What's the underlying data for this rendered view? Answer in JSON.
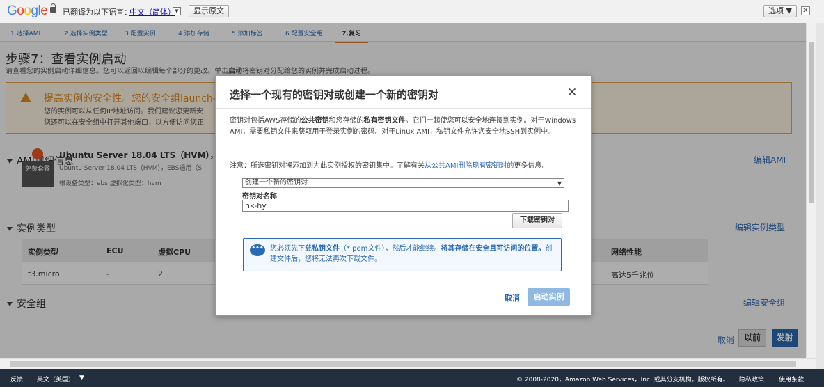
{
  "google_bar": {
    "translated_label": "已翻译为以下语言：",
    "language": "中文（简体）",
    "show_original": "显示原文",
    "options": "选项 ▼",
    "close": "✕"
  },
  "steps": [
    "1.选择AMI",
    "2.选择实例类型",
    "3.配置实例",
    "4.添加存储",
    "5.添加标签",
    "6.配置安全组",
    "7.复习"
  ],
  "page": {
    "title": "步骤7：查看实例启动",
    "subtitle_prefix": "请查看您的实例启动详细信息。您可以返回以编辑每个部分的更改。单击",
    "subtitle_bold": "启动",
    "subtitle_suffix": "将密钥对分配给您的实例并完成启动过程。",
    "warning_title": "提高实例的安全性。您的安全组launch-w",
    "warning_line1": "您的实例可以从任何IP地址访问。我们建议您更新安",
    "warning_line2": "您还可以在安全组中打开其他端口，以方便访问您正"
  },
  "ami": {
    "section": "AMI详细信息",
    "edit": "编辑AMI",
    "free_tag": "免费套餐",
    "name": "Ubuntu Server 18.04 LTS（HVM），SSD卷",
    "desc": "Ubuntu Server 18.04 LTS（HVM），EBS通用（S",
    "meta": "根设备类型：ebs    虚拟化类型：hvm"
  },
  "instance_type": {
    "section": "实例类型",
    "edit": "编辑实例类型",
    "headers": [
      "实例类型",
      "ECU",
      "虚拟CPU",
      "网络性能"
    ],
    "row": [
      "t3.micro",
      "-",
      "2",
      "高达5千兆位"
    ]
  },
  "security_group": {
    "section": "安全组",
    "edit": "编辑安全组"
  },
  "bottom_nav": {
    "cancel": "取消",
    "previous": "以前",
    "launch": "发射"
  },
  "footer": {
    "feedback": "反馈",
    "language": "英文（美国）",
    "copyright": "© 2008-2020，Amazon Web Services，Inc. 或其分支机构。版权所有。",
    "privacy": "隐私政策",
    "terms": "使用条款"
  },
  "modal": {
    "title": "选择一个现有的密钥对或创建一个新的密钥对",
    "close": "✕",
    "p1_a": "密钥对包括AWS存储的",
    "p1_b": "公共密钥",
    "p1_c": "和您存储的",
    "p1_d": "私有密钥文件",
    "p1_e": "。它们一起使您可以安全地连接到实例。对于Windows AMI，需要私钥文件来获取用于登录实例的密码。对于Linux AMI，私钥文件允许您安全地SSH到实例中。",
    "note_a": "注意：所选密钥对将添加到为此实例授权的密钥集中。了解有关",
    "note_link": "从公共AMI删除现有密钥对的",
    "note_b": "更多信息。",
    "select_value": "创建一个新的密钥对",
    "key_name_label": "密钥对名称",
    "key_name_value": "hk-hy",
    "download": "下载密钥对",
    "info_a": "您必须先下载",
    "info_b": "私钥文件",
    "info_c": "（*.pem文件），然后才能继续。",
    "info_d": "将其存储在安全且可访问的位置。",
    "info_e": "创建文件后，您将无法再次下载文件。",
    "cancel": "取消",
    "launch": "启动实例"
  },
  "colors": {
    "accent": "#2a6ab3",
    "warning": "#dd8a1d",
    "footer_bg": "#232f3e"
  }
}
